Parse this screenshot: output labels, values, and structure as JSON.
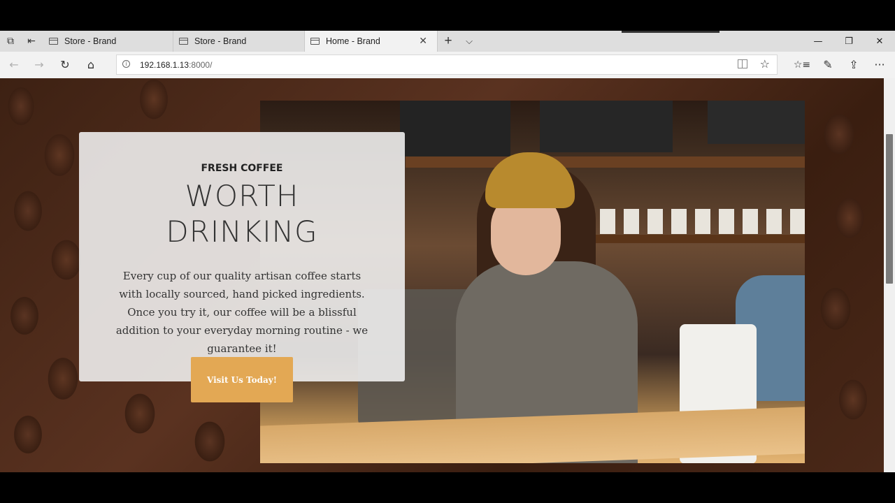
{
  "browser": {
    "tabs": [
      {
        "title": "Store - Brand",
        "active": false
      },
      {
        "title": "Store - Brand",
        "active": false
      },
      {
        "title": "Home - Brand",
        "active": true
      }
    ],
    "new_tab_icon": "+",
    "tab_menu_icon": "chevron-down",
    "window_controls": {
      "minimize": "—",
      "maximize": "❐",
      "close": "✕"
    },
    "nav": {
      "back": "←",
      "forward": "→",
      "refresh": "↻",
      "home": "⌂"
    },
    "address": {
      "host": "192.168.1.13",
      "port": ":8000/"
    },
    "toolbar_icons": {
      "favorites": "☆≡",
      "notes": "✎",
      "share": "⇪",
      "more": "···"
    }
  },
  "hero": {
    "eyebrow": "FRESH COFFEE",
    "headline_line1": "WORTH",
    "headline_line2": "DRINKING",
    "body": "Every cup of our quality artisan coffee starts with locally sourced, hand picked ingredients. Once you try it, our coffee will be a blissful addition to your everyday morning routine - we guarantee it!",
    "cta_label": "Visit Us Today!"
  },
  "colors": {
    "accent": "#e3a854",
    "background": "#3d2113"
  }
}
